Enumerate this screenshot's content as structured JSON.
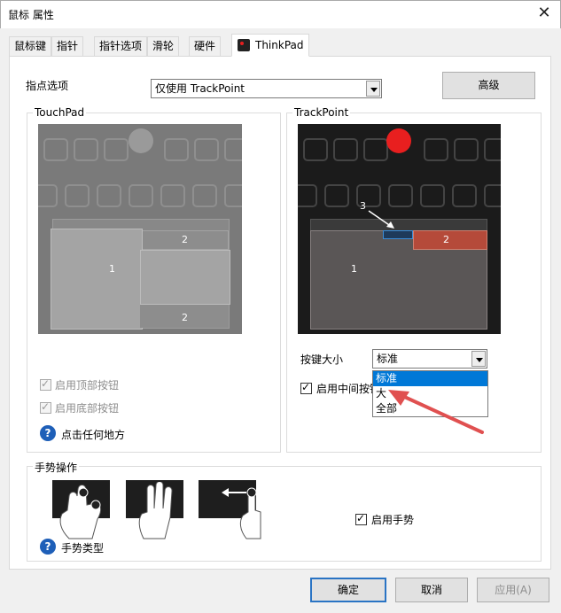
{
  "window": {
    "title": "鼠标 属性",
    "close_symbol": "✕"
  },
  "tabs": [
    {
      "label": "鼠标键"
    },
    {
      "label": "指针"
    },
    {
      "label": "指针选项"
    },
    {
      "label": "滑轮"
    },
    {
      "label": "硬件"
    },
    {
      "label": "ThinkPad",
      "active": true
    }
  ],
  "pointing": {
    "label": "指点选项",
    "selected": "仅使用 TrackPoint",
    "advanced_label": "高级"
  },
  "touchpad": {
    "group_label": "TouchPad",
    "zone1": "1",
    "zone2a": "2",
    "zone2b": "2",
    "top_buttons_label": "启用顶部按钮",
    "bottom_buttons_label": "启用底部按钮",
    "click_anywhere_label": "点击任何地方"
  },
  "trackpoint": {
    "group_label": "TrackPoint",
    "zone1": "1",
    "zone2": "2",
    "zone3": "3",
    "key_size_label": "按键大小",
    "key_size_selected": "标准",
    "key_size_options": [
      "标准",
      "大",
      "全部"
    ],
    "middle_button_label": "启用中间按钮"
  },
  "gestures": {
    "group_label": "手势操作",
    "enable_label": "启用手势",
    "type_label": "手势类型"
  },
  "footer": {
    "ok_label": "确定",
    "cancel_label": "取消",
    "apply_label": "应用(A)"
  },
  "colors": {
    "trackpoint_red": "#e81f1f",
    "zone2_red": "#b54a3a",
    "selection_blue": "#0078d7",
    "arrow_red": "#e05050"
  }
}
